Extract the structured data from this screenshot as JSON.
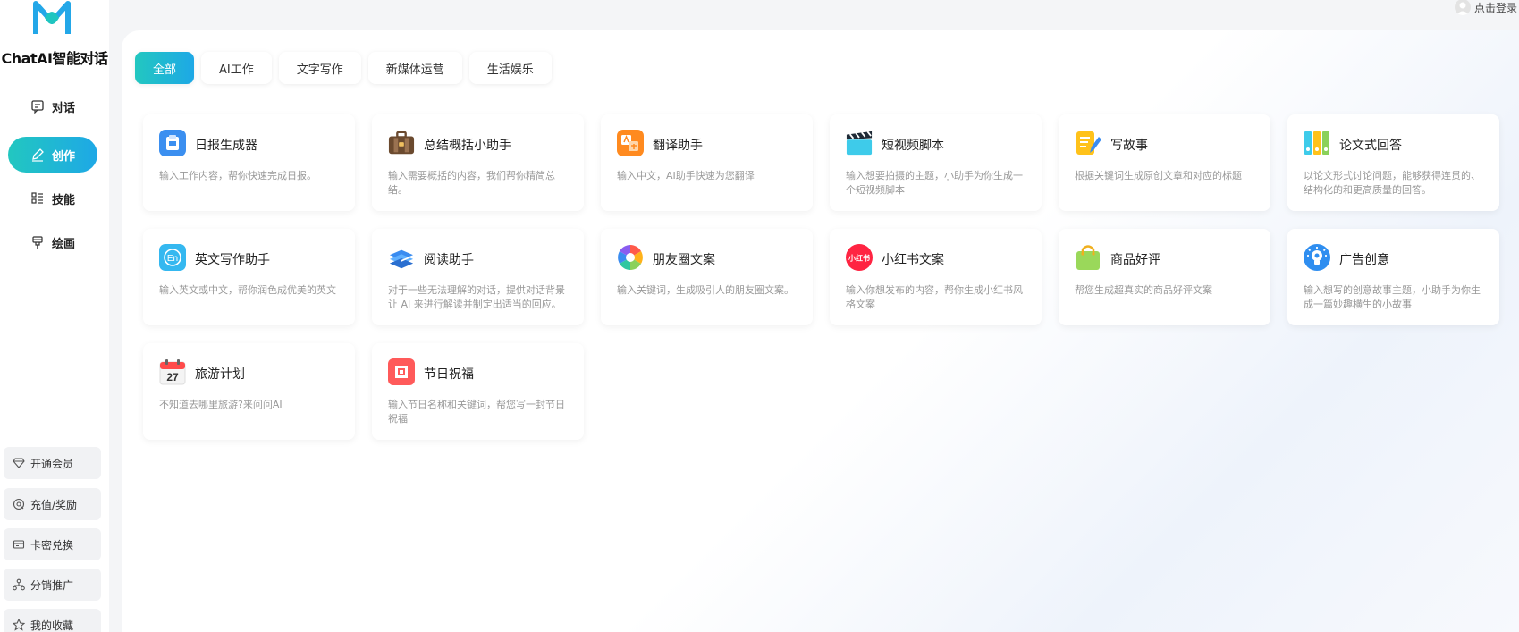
{
  "app": {
    "title": "ChatAI智能对话"
  },
  "login": {
    "label": "点击登录"
  },
  "nav": [
    {
      "label": "对话",
      "icon": "chat-icon"
    },
    {
      "label": "创作",
      "icon": "pen-icon"
    },
    {
      "label": "技能",
      "icon": "list-icon"
    },
    {
      "label": "绘画",
      "icon": "brush-icon"
    }
  ],
  "side_buttons": [
    {
      "label": "开通会员",
      "icon": "diamond-icon"
    },
    {
      "label": "充值/奖励",
      "icon": "gift-icon"
    },
    {
      "label": "卡密兑换",
      "icon": "card-icon"
    },
    {
      "label": "分销推广",
      "icon": "share-network-icon"
    },
    {
      "label": "我的收藏",
      "icon": "star-icon"
    }
  ],
  "tabs": [
    {
      "label": "全部",
      "active": true
    },
    {
      "label": "AI工作"
    },
    {
      "label": "文字写作"
    },
    {
      "label": "新媒体运营"
    },
    {
      "label": "生活娱乐"
    }
  ],
  "cards": [
    {
      "title": "日报生成器",
      "desc": "输入工作内容，帮你快速完成日报。",
      "icon": "daily-report-icon"
    },
    {
      "title": "总结概括小助手",
      "desc": "输入需要概括的内容，我们帮你精简总结。",
      "icon": "briefcase-icon"
    },
    {
      "title": "翻译助手",
      "desc": "输入中文，AI助手快速为您翻译",
      "icon": "translate-icon"
    },
    {
      "title": "短视频脚本",
      "desc": "输入想要拍摄的主题，小助手为你生成一个短视频脚本",
      "icon": "clapperboard-icon"
    },
    {
      "title": "写故事",
      "desc": "根据关键词生成原创文章和对应的标题",
      "icon": "notepad-pencil-icon"
    },
    {
      "title": "论文式回答",
      "desc": "以论文形式讨论问题，能够获得连贯的、结构化的和更高质量的回答。",
      "icon": "binders-icon"
    },
    {
      "title": "英文写作助手",
      "desc": "输入英文或中文，帮你润色成优美的英文",
      "icon": "english-icon"
    },
    {
      "title": "阅读助手",
      "desc": "对于一些无法理解的对话，提供对话背景让 AI 来进行解读并制定出适当的回应。",
      "icon": "books-icon"
    },
    {
      "title": "朋友圈文案",
      "desc": "输入关键词，生成吸引人的朋友圈文案。",
      "icon": "aperture-icon"
    },
    {
      "title": "小红书文案",
      "desc": "输入你想发布的内容，帮你生成小红书风格文案",
      "icon": "xiaohongshu-icon"
    },
    {
      "title": "商品好评",
      "desc": "帮您生成超真实的商品好评文案",
      "icon": "shopping-bag-icon"
    },
    {
      "title": "广告创意",
      "desc": "输入想写的创意故事主题，小助手为你生成一篇妙趣横生的小故事",
      "icon": "lightbulb-gear-icon"
    },
    {
      "title": "旅游计划",
      "desc": "不知道去哪里旅游?来问问AI",
      "icon": "calendar-icon"
    },
    {
      "title": "节日祝福",
      "desc": "输入节日名称和关键词，帮您写一封节日祝福",
      "icon": "festival-icon"
    }
  ],
  "icon_labels": {
    "calendar_day": "27",
    "xiaohongshu": "小红书",
    "english": "En"
  },
  "colors": {
    "accent_start": "#22c7c0",
    "accent_end": "#1ea8e6",
    "background": "#f4f5f7"
  }
}
